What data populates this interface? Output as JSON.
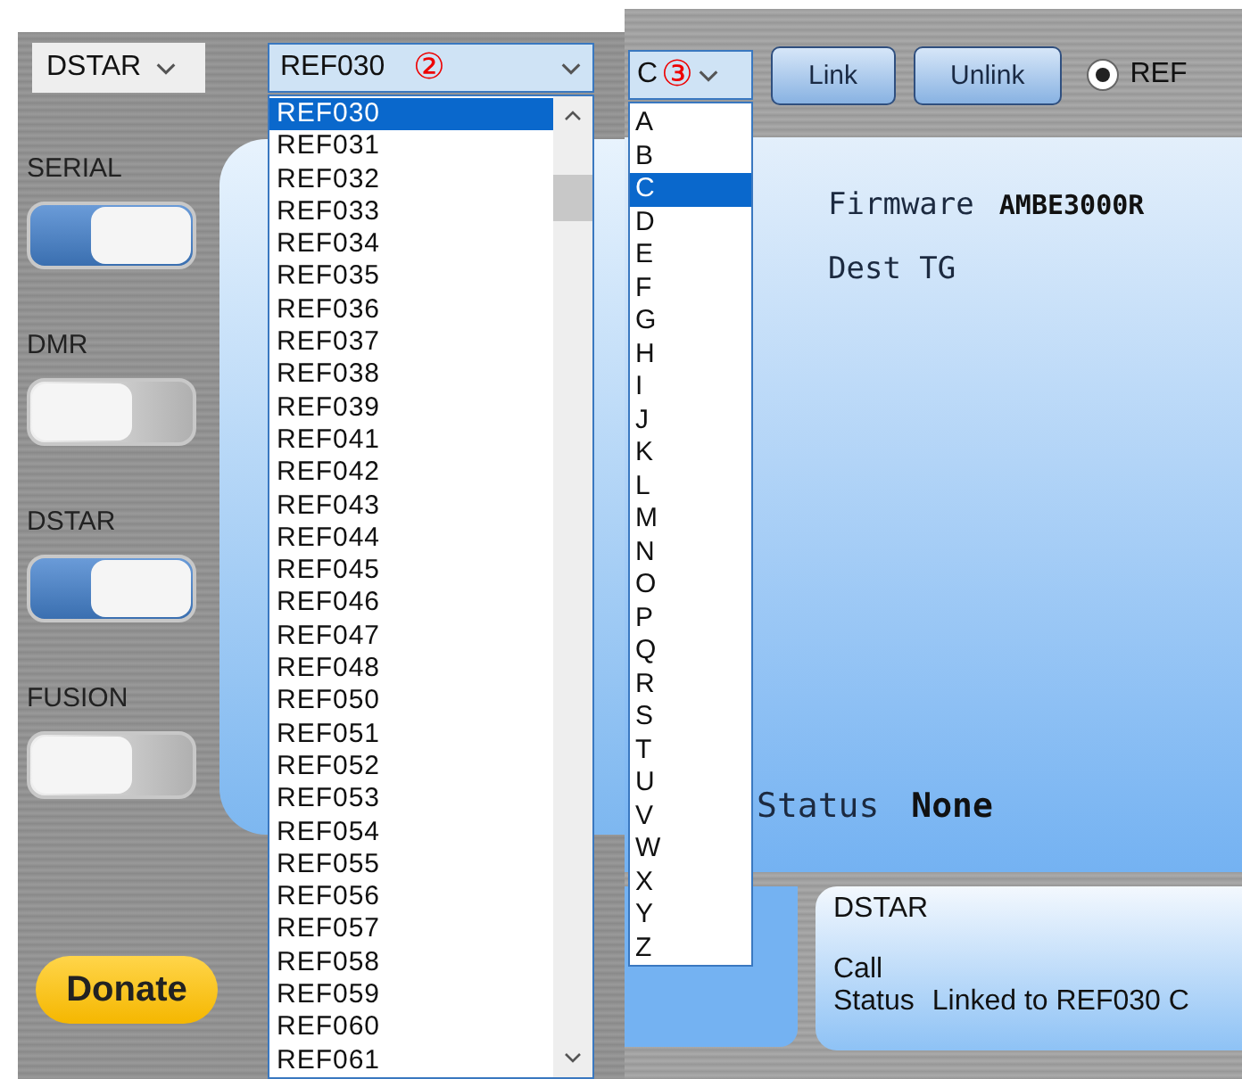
{
  "left_panel": {
    "mode_select": {
      "value": "DSTAR"
    },
    "reflector_select": {
      "value": "REF030",
      "annotation": "②",
      "expanded": true,
      "options": [
        {
          "label": "REF030",
          "selected": true
        },
        {
          "label": "REF031",
          "selected": false
        },
        {
          "label": "REF032",
          "selected": false
        },
        {
          "label": "REF033",
          "selected": false
        },
        {
          "label": "REF034",
          "selected": false
        },
        {
          "label": "REF035",
          "selected": false
        },
        {
          "label": "REF036",
          "selected": false
        },
        {
          "label": "REF037",
          "selected": false
        },
        {
          "label": "REF038",
          "selected": false
        },
        {
          "label": "REF039",
          "selected": false
        },
        {
          "label": "REF041",
          "selected": false
        },
        {
          "label": "REF042",
          "selected": false
        },
        {
          "label": "REF043",
          "selected": false
        },
        {
          "label": "REF044",
          "selected": false
        },
        {
          "label": "REF045",
          "selected": false
        },
        {
          "label": "REF046",
          "selected": false
        },
        {
          "label": "REF047",
          "selected": false
        },
        {
          "label": "REF048",
          "selected": false
        },
        {
          "label": "REF050",
          "selected": false
        },
        {
          "label": "REF051",
          "selected": false
        },
        {
          "label": "REF052",
          "selected": false
        },
        {
          "label": "REF053",
          "selected": false
        },
        {
          "label": "REF054",
          "selected": false
        },
        {
          "label": "REF055",
          "selected": false
        },
        {
          "label": "REF056",
          "selected": false
        },
        {
          "label": "REF057",
          "selected": false
        },
        {
          "label": "REF058",
          "selected": false
        },
        {
          "label": "REF059",
          "selected": false
        },
        {
          "label": "REF060",
          "selected": false
        },
        {
          "label": "REF061",
          "selected": false
        }
      ]
    },
    "toggles": [
      {
        "label": "SERIAL",
        "on": true
      },
      {
        "label": "DMR",
        "on": false
      },
      {
        "label": "DSTAR",
        "on": true
      },
      {
        "label": "FUSION",
        "on": false
      }
    ],
    "donate_button": "Donate"
  },
  "right_panel": {
    "module_select": {
      "value": "C",
      "annotation": "③",
      "expanded": true,
      "options": [
        {
          "label": "A",
          "selected": false
        },
        {
          "label": "B",
          "selected": false
        },
        {
          "label": "C",
          "selected": true
        },
        {
          "label": "D",
          "selected": false
        },
        {
          "label": "E",
          "selected": false
        },
        {
          "label": "F",
          "selected": false
        },
        {
          "label": "G",
          "selected": false
        },
        {
          "label": "H",
          "selected": false
        },
        {
          "label": "I",
          "selected": false
        },
        {
          "label": "J",
          "selected": false
        },
        {
          "label": "K",
          "selected": false
        },
        {
          "label": "L",
          "selected": false
        },
        {
          "label": "M",
          "selected": false
        },
        {
          "label": "N",
          "selected": false
        },
        {
          "label": "O",
          "selected": false
        },
        {
          "label": "P",
          "selected": false
        },
        {
          "label": "Q",
          "selected": false
        },
        {
          "label": "R",
          "selected": false
        },
        {
          "label": "S",
          "selected": false
        },
        {
          "label": "T",
          "selected": false
        },
        {
          "label": "U",
          "selected": false
        },
        {
          "label": "V",
          "selected": false
        },
        {
          "label": "W",
          "selected": false
        },
        {
          "label": "X",
          "selected": false
        },
        {
          "label": "Y",
          "selected": false
        },
        {
          "label": "Z",
          "selected": false
        }
      ]
    },
    "buttons": [
      "Link",
      "Unlink"
    ],
    "radio": {
      "label": "REF",
      "selected": true
    },
    "info": [
      {
        "label": "Firmware",
        "value": "AMBE3000R"
      },
      {
        "label": "Dest TG"
      }
    ],
    "status": {
      "label": "Status",
      "value": "None"
    },
    "mode_card": {
      "title": "DSTAR",
      "rows": [
        {
          "label": "Call"
        },
        {
          "label": "Status",
          "value": "Linked to REF030 C"
        }
      ]
    }
  }
}
